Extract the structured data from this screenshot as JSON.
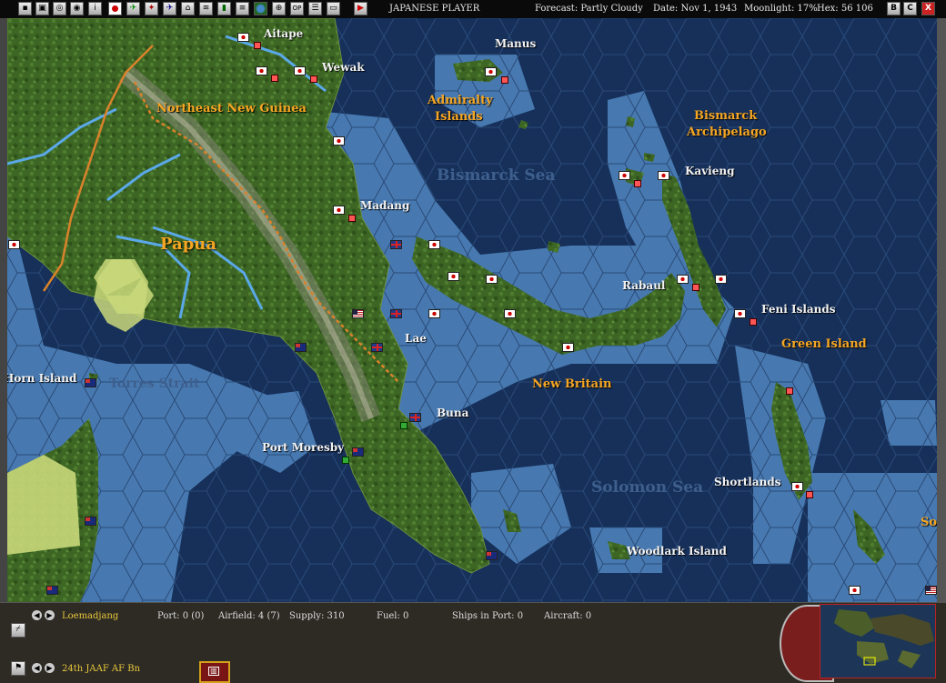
{
  "toolbar": {
    "buttons": [
      "save-icon",
      "load-icon",
      "report-icon",
      "report2-icon",
      "info-icon",
      "japan-flag-icon",
      "aircraft-icon",
      "ship-icon",
      "plane-icon",
      "chart-icon",
      "route-icon",
      "group-icon",
      "globe-icon",
      "map-icon",
      "op-label",
      "list-icon",
      "screen-icon",
      "end-turn-icon"
    ],
    "op_label": "OP",
    "player": "JAPANESE PLAYER",
    "forecast": "Forecast: Partly Cloudy",
    "date": "Date: Nov 1, 1943",
    "moonlight": "Moonlight: 17%",
    "hex": "Hex: 56 106",
    "right_buttons": [
      "B",
      "C"
    ],
    "close_label": "X"
  },
  "map_labels": {
    "aitape": "Aitape",
    "wewak": "Wewak",
    "manus": "Manus",
    "admiralty": "Admiralty",
    "islands": "Islands",
    "northeast_new_guinea": "Northeast New Guinea",
    "bismarck": "Bismarck",
    "archipelago": "Archipelago",
    "bismarck_sea": "Bismarck Sea",
    "kavieng": "Kavieng",
    "madang": "Madang",
    "papua": "Papua",
    "rabaul": "Rabaul",
    "feni_islands": "Feni Islands",
    "green_island": "Green Island",
    "lae": "Lae",
    "horn_island": "Horn Island",
    "torres_strait": "Torres Strait",
    "new_britain": "New Britain",
    "buna": "Buna",
    "port_moresby": "Port Moresby",
    "solomon_sea": "Solomon Sea",
    "shortlands": "Shortlands",
    "woodlark_island": "Woodlark Island",
    "sol": "Sol"
  },
  "bottom_panel": {
    "location": "Loemadjang",
    "port": "Port: 0 (0)",
    "airfield": "Airfield: 4 (7)",
    "supply": "Supply: 310",
    "fuel": "Fuel: 0",
    "ships_in_port": "Ships in Port: 0",
    "aircraft": "Aircraft: 0",
    "unit": "24th JAAF AF Bn"
  },
  "colors": {
    "ocean_deep": "#16305a",
    "ocean_shallow": "#4a7db5",
    "land": "#3f6a25",
    "region_label": "#f5a623",
    "highlight_hex": "#c9d87a"
  }
}
